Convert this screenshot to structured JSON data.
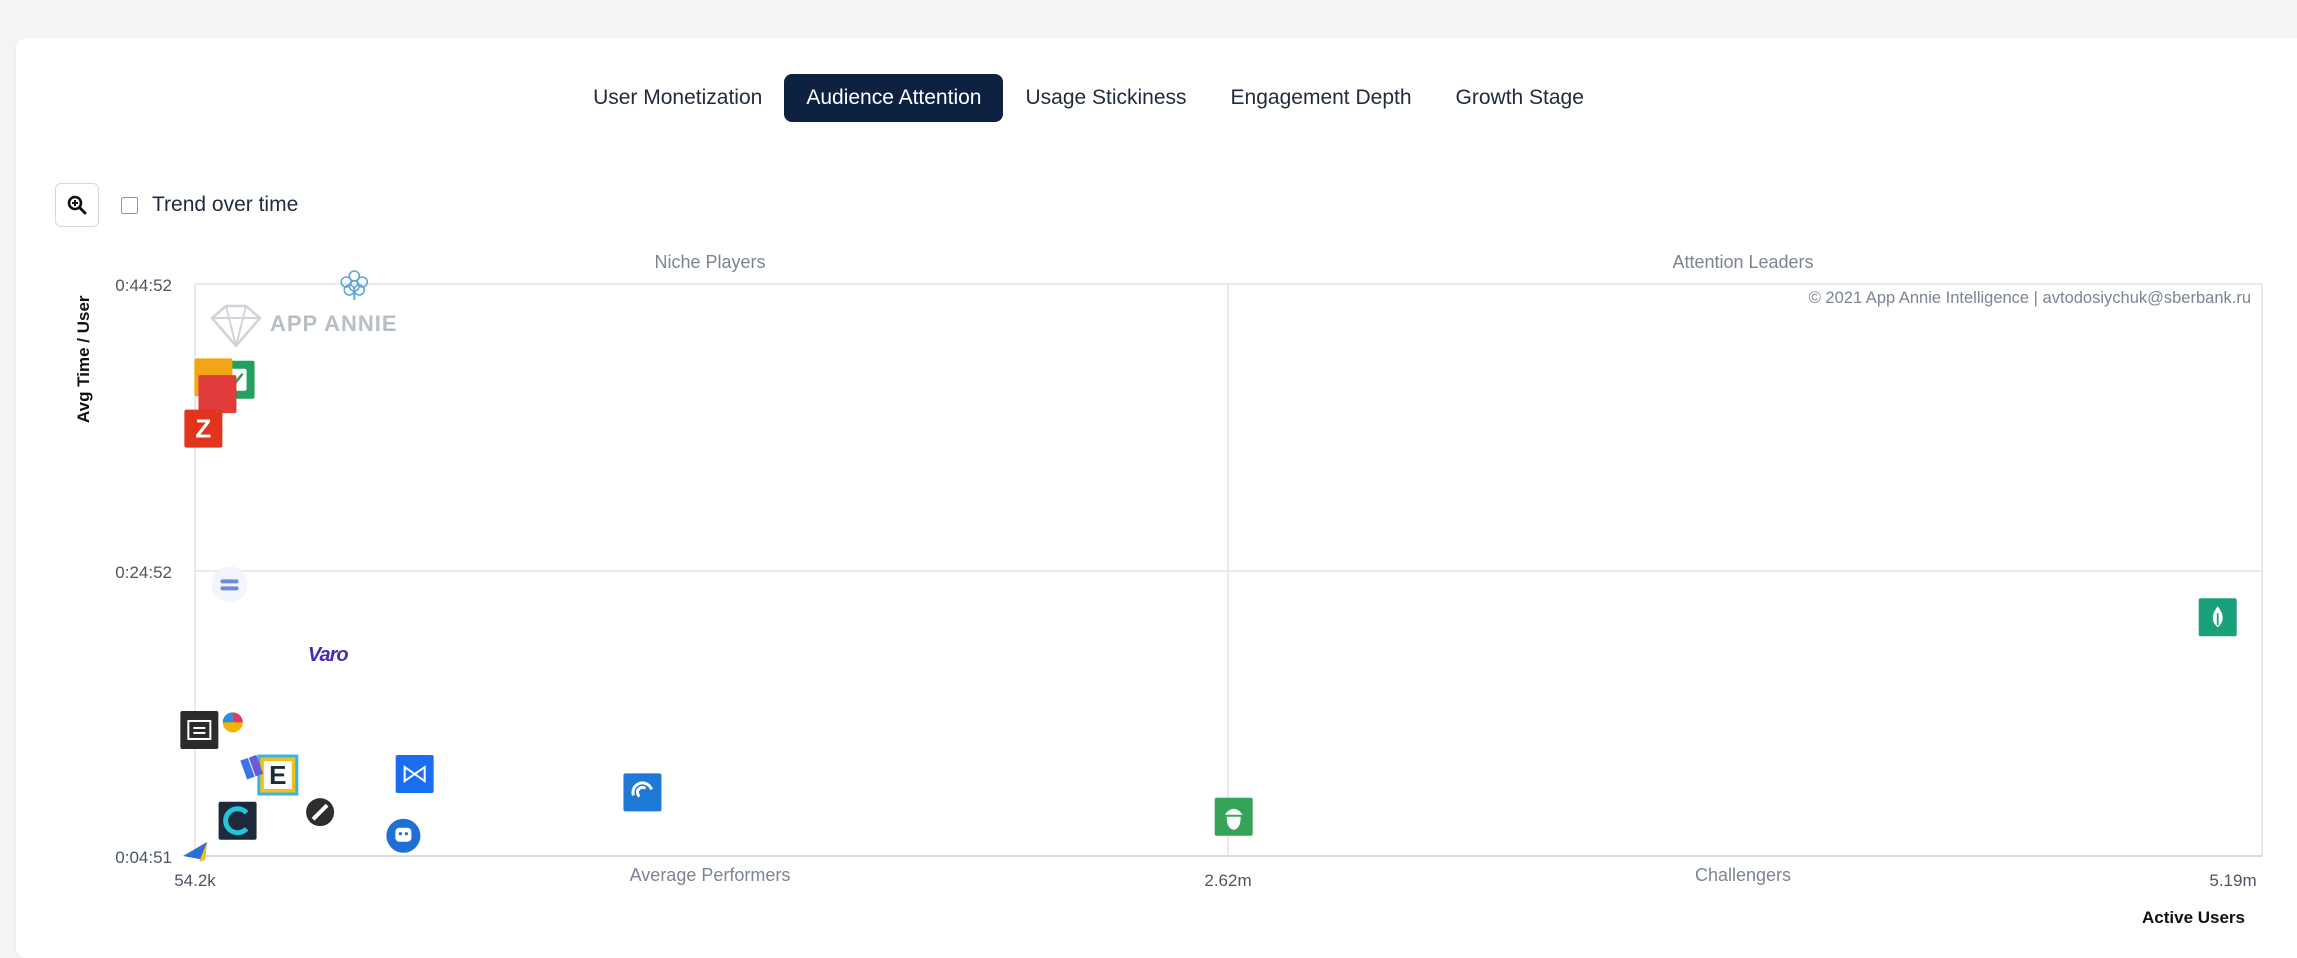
{
  "tabs": [
    {
      "label": "User Monetization",
      "active": false
    },
    {
      "label": "Audience Attention",
      "active": true
    },
    {
      "label": "Usage Stickiness",
      "active": false
    },
    {
      "label": "Engagement Depth",
      "active": false
    },
    {
      "label": "Growth Stage",
      "active": false
    }
  ],
  "controls": {
    "zoom_icon": "zoom-in-icon",
    "trend_label": "Trend over time",
    "trend_checked": false
  },
  "watermark": {
    "logo_text": "APP ANNIE",
    "copyright": "© 2021 App Annie Intelligence | avtodosiychuk@sberbank.ru"
  },
  "chart_data": {
    "type": "scatter",
    "xlabel": "Active Users",
    "ylabel": "Avg Time / User",
    "x_ticks": [
      "54.2k",
      "2.62m",
      "5.19m"
    ],
    "y_ticks": [
      "0:44:52",
      "0:24:52",
      "0:04:51"
    ],
    "xlim": [
      54200,
      5190000
    ],
    "ylim_seconds": [
      291,
      2692
    ],
    "grid": true,
    "quadrants": {
      "top_left": "Niche Players",
      "top_right": "Attention Leaders",
      "bottom_left": "Average Performers",
      "bottom_right": "Challengers"
    },
    "points": [
      {
        "label": "tree",
        "x": 450000,
        "y": 2692,
        "color": "#5fa8d3"
      },
      {
        "label": "green-card",
        "x": 155000,
        "y": 2290,
        "color": "#22a060"
      },
      {
        "label": "orange-card",
        "x": 100000,
        "y": 2300,
        "color": "#f2a516"
      },
      {
        "label": "red-card",
        "x": 110000,
        "y": 2230,
        "color": "#e03c3c"
      },
      {
        "label": "red-z",
        "x": 75000,
        "y": 2085,
        "color": "#e0341c"
      },
      {
        "label": "equals",
        "x": 140000,
        "y": 1431,
        "color": "#6f8bd8"
      },
      {
        "label": "Varo",
        "x": 384000,
        "y": 1130,
        "color": "#4b2bb0"
      },
      {
        "label": "dark-card",
        "x": 65000,
        "y": 820,
        "color": "#2b2b2b"
      },
      {
        "label": "multi-color",
        "x": 148000,
        "y": 852,
        "color": "#e0386c"
      },
      {
        "label": "E",
        "x": 260000,
        "y": 631,
        "color": "#f2c01e"
      },
      {
        "label": "blue-purple-stack",
        "x": 205000,
        "y": 661,
        "color": "#6a5cd6"
      },
      {
        "label": "bowtie",
        "x": 600000,
        "y": 635,
        "color": "#1a6ff0"
      },
      {
        "label": "swirl",
        "x": 1166000,
        "y": 558,
        "color": "#1e78d6"
      },
      {
        "label": "C",
        "x": 160000,
        "y": 439,
        "color": "#1c2a3a"
      },
      {
        "label": "slash",
        "x": 365000,
        "y": 475,
        "color": "#2e2e2e"
      },
      {
        "label": "chat",
        "x": 572000,
        "y": 376,
        "color": "#1e6fd6"
      },
      {
        "label": "acorn",
        "x": 2635000,
        "y": 456,
        "color": "#36a456"
      },
      {
        "label": "arrow",
        "x": 54200,
        "y": 291,
        "color": "#2a6fd6"
      },
      {
        "label": "drop",
        "x": 5080000,
        "y": 1293,
        "color": "#1aa07a"
      }
    ]
  }
}
